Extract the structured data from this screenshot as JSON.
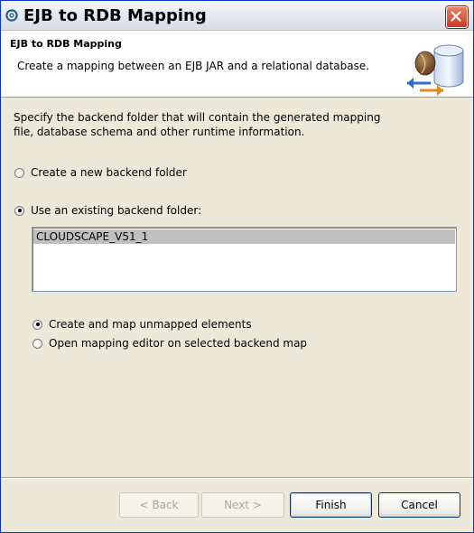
{
  "window": {
    "title": "EJB to RDB Mapping"
  },
  "header": {
    "title": "EJB to RDB Mapping",
    "description": "Create a mapping between an EJB JAR and a relational database."
  },
  "body": {
    "instructions": "Specify the backend folder that will contain the generated mapping file, database schema and other runtime information.",
    "option_new": {
      "label": "Create a new backend folder",
      "checked": false
    },
    "option_existing": {
      "label": "Use an existing backend folder:",
      "checked": true
    },
    "backend_folders": [
      "CLOUDSCAPE_V51_1"
    ],
    "selected_folder": "CLOUDSCAPE_V51_1",
    "sub_option_create": {
      "label": "Create and map unmapped elements",
      "checked": true
    },
    "sub_option_open": {
      "label": "Open mapping editor on selected backend map",
      "checked": false
    }
  },
  "buttons": {
    "back": "< Back",
    "next": "Next >",
    "finish": "Finish",
    "cancel": "Cancel"
  },
  "colors": {
    "title_bar": "#E6E9F0",
    "window_bg": "#ECE9D8",
    "close_button": "#C6391F",
    "selection": "#C0C0C0"
  },
  "icons": {
    "app": "eclipse-app-icon",
    "close": "close-icon",
    "banner": "ejb-rdb-mapping-wizard-icon"
  }
}
